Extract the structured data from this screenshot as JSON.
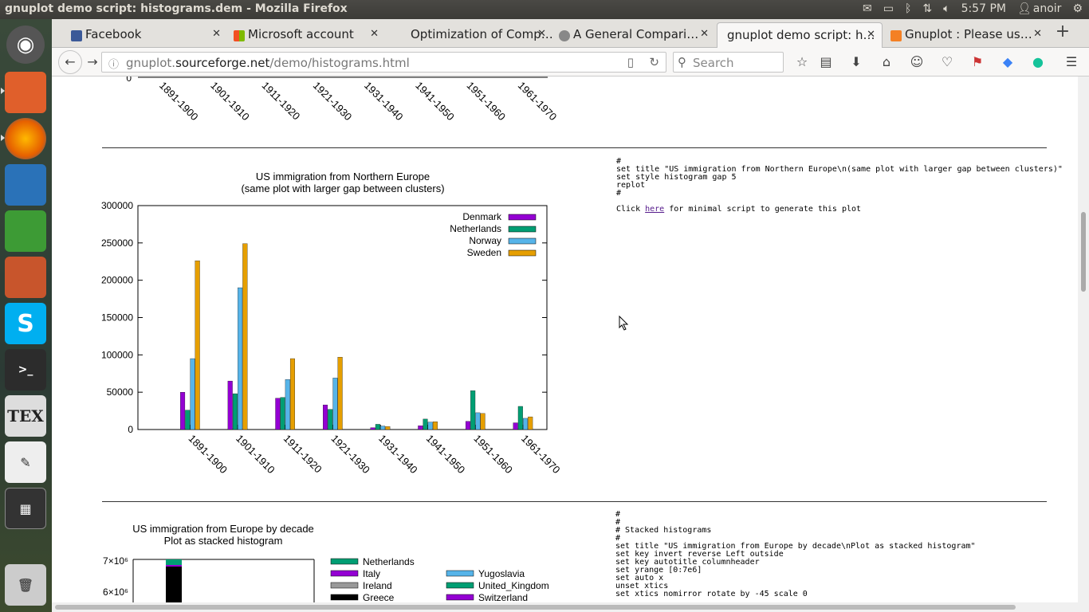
{
  "window_title": "gnuplot demo script: histograms.dem - Mozilla Firefox",
  "tray": {
    "time": "5:57 PM",
    "user": "anoir"
  },
  "tabs": [
    {
      "label": "Facebook",
      "color": "#3b5998"
    },
    {
      "label": "Microsoft account",
      "color": "#f25022"
    },
    {
      "label": "Optimization of Comp…",
      "color": ""
    },
    {
      "label": "A General Compari…",
      "color": "#555"
    },
    {
      "label": "gnuplot demo script: h…",
      "color": ""
    },
    {
      "label": "Gnuplot : Please us…",
      "color": "#f48024"
    }
  ],
  "url": {
    "prefix": "gnuplot.",
    "domain": "sourceforge.net",
    "path": "/demo/histograms.html"
  },
  "search_placeholder": "Search",
  "prev_chart": {
    "x_ticks": [
      "1891-1900",
      "1901-1910",
      "1911-1920",
      "1921-1930",
      "1931-1940",
      "1941-1950",
      "1951-1960",
      "1961-1970"
    ],
    "y_zero": "0"
  },
  "section1": {
    "code": "#\nset title \"US immigration from Northern Europe\\n(same plot with larger gap between clusters)\"\nset style histogram gap 5\nreplot\n#",
    "click_prefix": "Click ",
    "click_link": "here",
    "click_suffix": " for minimal script to generate this plot"
  },
  "chart_data": {
    "type": "bar",
    "title": "US immigration from Northern Europe",
    "subtitle": "(same plot with larger gap between clusters)",
    "categories": [
      "1891-1900",
      "1901-1910",
      "1911-1920",
      "1921-1930",
      "1931-1940",
      "1941-1950",
      "1951-1960",
      "1961-1970"
    ],
    "ylim": [
      0,
      300000
    ],
    "y_ticks": [
      "0",
      "50000",
      "100000",
      "150000",
      "200000",
      "250000",
      "300000"
    ],
    "legend_position": "top-right",
    "series": [
      {
        "name": "Denmark",
        "color": "#9400d3",
        "values": [
          50000,
          65000,
          42000,
          33000,
          2500,
          5000,
          11000,
          9000
        ]
      },
      {
        "name": "Netherlands",
        "color": "#009e73",
        "values": [
          26000,
          48000,
          43000,
          27000,
          7000,
          14000,
          52000,
          31000
        ]
      },
      {
        "name": "Norway",
        "color": "#56b4e9",
        "values": [
          95000,
          190000,
          67000,
          69000,
          4700,
          10000,
          22500,
          15000
        ]
      },
      {
        "name": "Sweden",
        "color": "#e69f00",
        "values": [
          226000,
          249000,
          95000,
          97000,
          3900,
          10500,
          21500,
          17000
        ]
      }
    ]
  },
  "section2": {
    "code": "#\n#\n# Stacked histograms\n#\nset title \"US immigration from Europe by decade\\nPlot as stacked histogram\"\nset key invert reverse Left outside\nset key autotitle columnheader\nset yrange [0:7e6]\nset auto x\nunset xtics\nset xtics nomirror rotate by -45 scale 0",
    "chart_title": "US immigration from Europe by decade",
    "chart_subtitle": "Plot as stacked histogram",
    "y_ticks": [
      "7×10⁶",
      "6×10⁶"
    ],
    "legend": [
      {
        "name": "Netherlands",
        "color": "#009e73"
      },
      {
        "name": "Italy",
        "color": "#9400d3"
      },
      {
        "name": "Yugoslavia",
        "color": "#56b4e9"
      },
      {
        "name": "Ireland",
        "color": "#999999"
      },
      {
        "name": "United_Kingdom",
        "color": "#009e73"
      },
      {
        "name": "Greece",
        "color": "#000000"
      },
      {
        "name": "Switzerland",
        "color": "#9400d3"
      }
    ]
  }
}
